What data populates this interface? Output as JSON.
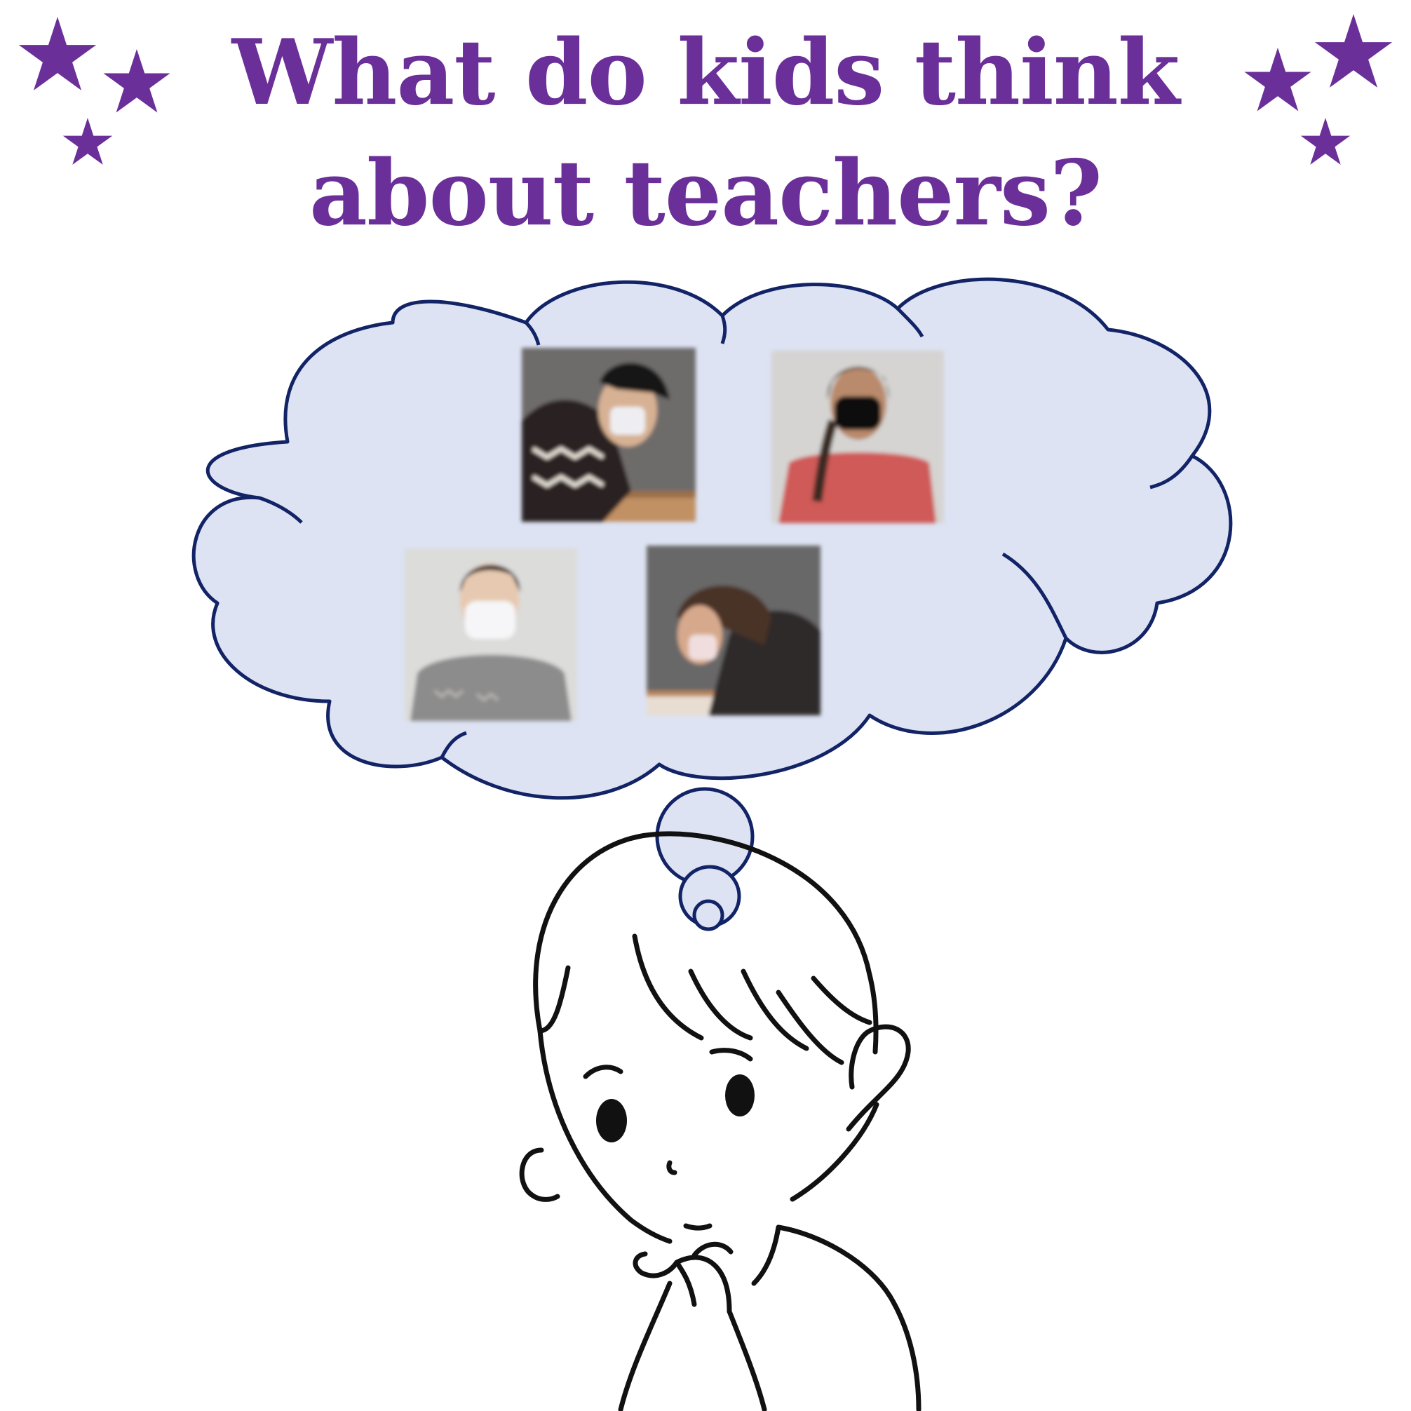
{
  "title": {
    "line1": "What do kids think",
    "line2": "about teachers?"
  },
  "colors": {
    "accent_purple": "#6a2f98",
    "cloud_fill": "#dde3f3",
    "cloud_stroke": "#122366",
    "ink": "#111111"
  },
  "icons": {
    "decoration": "star-icon",
    "bubble": "thought-bubble",
    "character": "thinking-child"
  }
}
